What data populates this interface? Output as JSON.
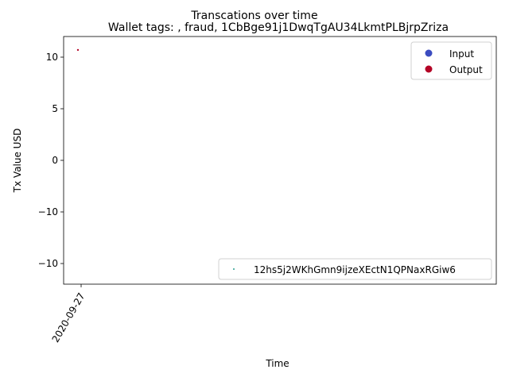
{
  "chart_data": {
    "type": "scatter",
    "suptitle": "Transcations over time",
    "title": "Wallet tags: , fraud, 1CbBge91j1DwqTgAU34LkmtPLBjrpZriza",
    "xlabel": "Time",
    "ylabel": "Tx Value USD",
    "ylim": [
      -12,
      12
    ],
    "y_ticks": [
      {
        "value": 10,
        "label": "10"
      },
      {
        "value": 5,
        "label": "5"
      },
      {
        "value": 0,
        "label": "0"
      },
      {
        "value": -5,
        "label": "−10"
      },
      {
        "value": -10,
        "label": "−10"
      }
    ],
    "x_ticks": [
      {
        "value": "2020-09-27",
        "label": "2020-09-27"
      }
    ],
    "legend_upper": {
      "placement": "upper-right",
      "entries": [
        {
          "label": "Input",
          "color": "#3b4cc0"
        },
        {
          "label": "Output",
          "color": "#b40426"
        }
      ]
    },
    "legend_lower": {
      "placement": "lower-right",
      "entries": [
        {
          "label": "12hs5j2WKhGmn9ijzeXEctN1QPNaxRGiw6",
          "color": "#2a9d8f"
        }
      ]
    },
    "series": [
      {
        "name": "Output",
        "color": "#b40426",
        "points": [
          {
            "x": "2020-09-27",
            "y": 10.7
          }
        ]
      }
    ]
  }
}
